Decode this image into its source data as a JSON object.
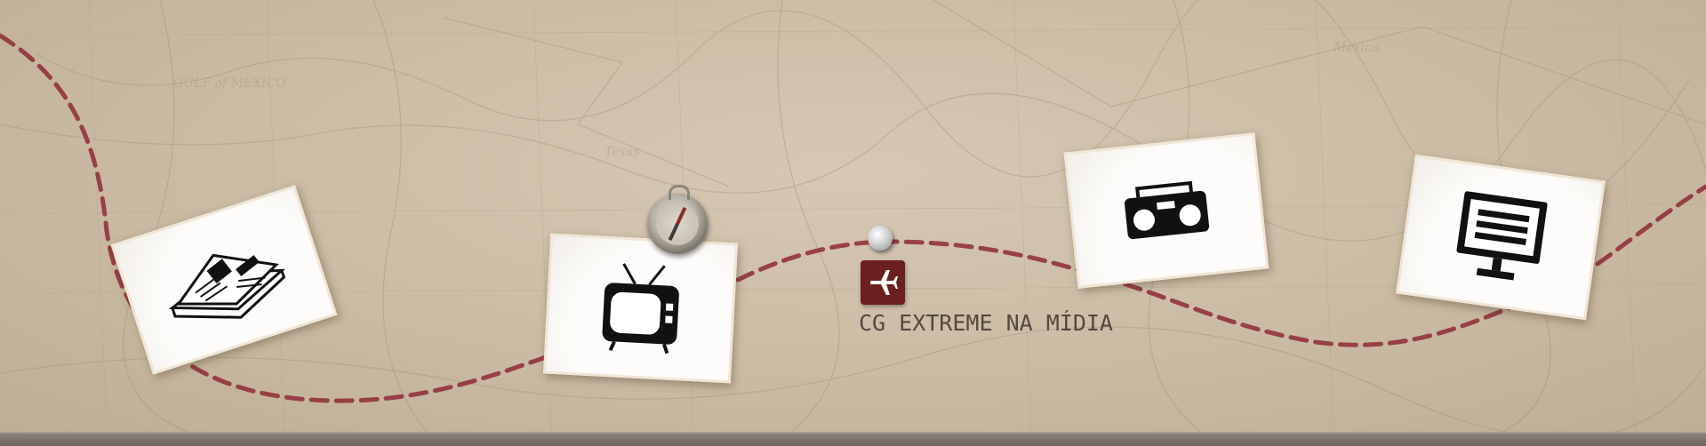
{
  "page": {
    "title": "CG EXTREME NA MÍDIA"
  },
  "cards": [
    {
      "name": "newspaper",
      "icon": "newspaper-icon"
    },
    {
      "name": "tv",
      "icon": "tv-icon"
    },
    {
      "name": "radio",
      "icon": "boombox-icon"
    },
    {
      "name": "screen",
      "icon": "monitor-icon"
    }
  ],
  "decorations": {
    "compass": "compass-icon",
    "pin": "pushpin-icon",
    "badge": "airplane-icon"
  },
  "colors": {
    "route": "#8e2a36",
    "badge": "#6b1f1f",
    "background": "#cbbba4",
    "title": "#4b3f37"
  }
}
